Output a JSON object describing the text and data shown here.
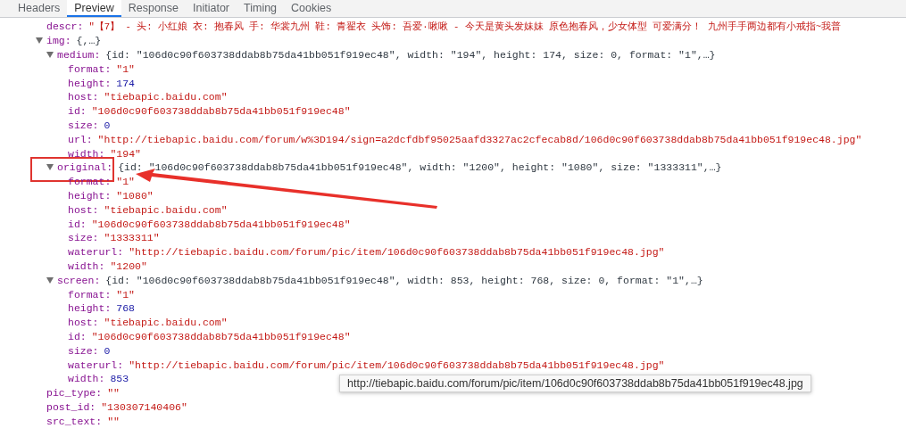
{
  "tabs": [
    {
      "label": "Headers",
      "selected": false
    },
    {
      "label": "Preview",
      "selected": true
    },
    {
      "label": "Response",
      "selected": false
    },
    {
      "label": "Initiator",
      "selected": false
    },
    {
      "label": "Timing",
      "selected": false
    },
    {
      "label": "Cookies",
      "selected": false
    }
  ],
  "tree": [
    {
      "key": "descr:",
      "kind": "string",
      "value": "\"【7】 - 头: 小红娘 衣: 抱春风 手: 华裳九州 鞋: 青翟衣 头饰: 吾爱·啾啾 - 今天是黄头发妹妹 原色抱春风，少女体型 可爱满分！ 九州手手两边都有小戒指~我普"
    },
    {
      "key": "img:",
      "kind": "object",
      "value": "{,…}",
      "expanded": true,
      "children": [
        {
          "key": "medium:",
          "kind": "object",
          "value": "{id: \"106d0c90f603738ddab8b75da41bb051f919ec48\", width: \"194\", height: 174, size: 0, format: \"1\",…}",
          "expanded": true,
          "children": [
            {
              "key": "format:",
              "kind": "string",
              "value": "\"1\""
            },
            {
              "key": "height:",
              "kind": "number",
              "value": "174"
            },
            {
              "key": "host:",
              "kind": "string",
              "value": "\"tiebapic.baidu.com\""
            },
            {
              "key": "id:",
              "kind": "string",
              "value": "\"106d0c90f603738ddab8b75da41bb051f919ec48\""
            },
            {
              "key": "size:",
              "kind": "number",
              "value": "0"
            },
            {
              "key": "url:",
              "kind": "string",
              "value": "\"http://tiebapic.baidu.com/forum/w%3D194/sign=a2dcfdbf95025aafd3327ac2cfecab8d/106d0c90f603738ddab8b75da41bb051f919ec48.jpg\""
            },
            {
              "key": "width:",
              "kind": "string",
              "value": "\"194\""
            }
          ]
        },
        {
          "key": "original:",
          "kind": "object",
          "value": "{id: \"106d0c90f603738ddab8b75da41bb051f919ec48\", width: \"1200\", height: \"1080\", size: \"1333311\",…}",
          "expanded": true,
          "highlighted": true,
          "children": [
            {
              "key": "format:",
              "kind": "string",
              "value": "\"1\""
            },
            {
              "key": "height:",
              "kind": "string",
              "value": "\"1080\""
            },
            {
              "key": "host:",
              "kind": "string",
              "value": "\"tiebapic.baidu.com\""
            },
            {
              "key": "id:",
              "kind": "string",
              "value": "\"106d0c90f603738ddab8b75da41bb051f919ec48\""
            },
            {
              "key": "size:",
              "kind": "string",
              "value": "\"1333311\""
            },
            {
              "key": "waterurl:",
              "kind": "string",
              "value": "\"http://tiebapic.baidu.com/forum/pic/item/106d0c90f603738ddab8b75da41bb051f919ec48.jpg\""
            },
            {
              "key": "width:",
              "kind": "string",
              "value": "\"1200\""
            }
          ]
        },
        {
          "key": "screen:",
          "kind": "object",
          "value": "{id: \"106d0c90f603738ddab8b75da41bb051f919ec48\", width: 853, height: 768, size: 0, format: \"1\",…}",
          "expanded": true,
          "children": [
            {
              "key": "format:",
              "kind": "string",
              "value": "\"1\""
            },
            {
              "key": "height:",
              "kind": "number",
              "value": "768"
            },
            {
              "key": "host:",
              "kind": "string",
              "value": "\"tiebapic.baidu.com\""
            },
            {
              "key": "id:",
              "kind": "string",
              "value": "\"106d0c90f603738ddab8b75da41bb051f919ec48\""
            },
            {
              "key": "size:",
              "kind": "number",
              "value": "0"
            },
            {
              "key": "waterurl:",
              "kind": "string",
              "value": "\"http://tiebapic.baidu.com/forum/pic/item/106d0c90f603738ddab8b75da41bb051f919ec48.jpg\""
            },
            {
              "key": "width:",
              "kind": "number",
              "value": "853"
            }
          ]
        }
      ]
    },
    {
      "key": "pic_type:",
      "kind": "string",
      "value": "\"\""
    },
    {
      "key": "post_id:",
      "kind": "string",
      "value": "\"130307140406\""
    },
    {
      "key": "src_text:",
      "kind": "string",
      "value": "\"\""
    }
  ],
  "tooltip": "http://tiebapic.baidu.com/forum/pic/item/106d0c90f603738ddab8b75da41bb051f919ec48.jpg"
}
